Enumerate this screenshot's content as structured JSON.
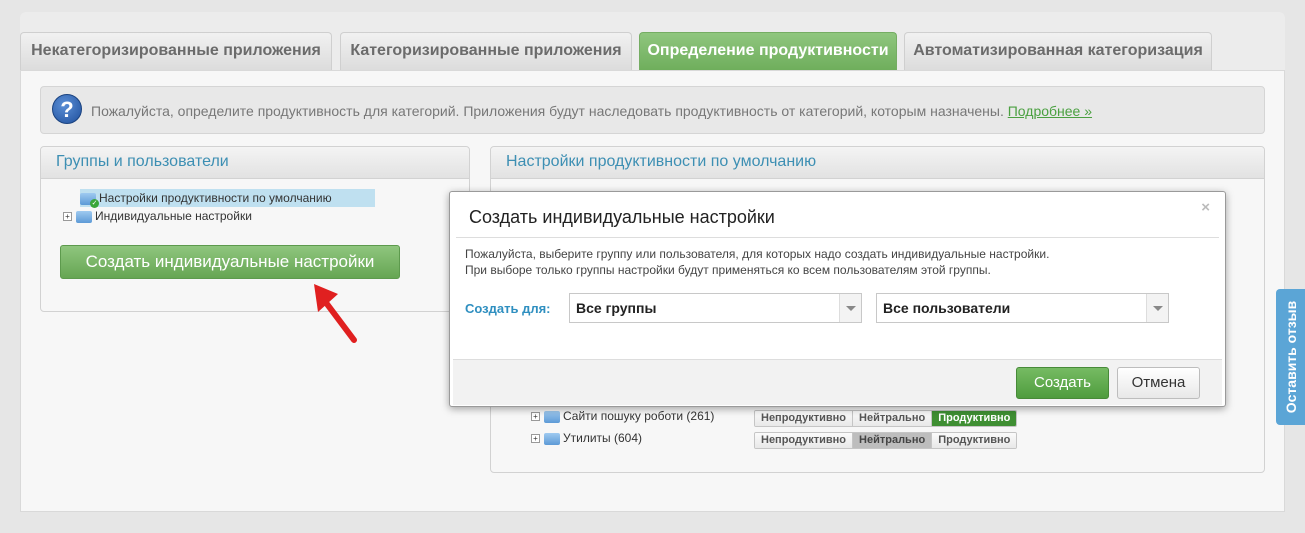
{
  "tabs": [
    {
      "label": "Некатегоризированные приложения",
      "active": false
    },
    {
      "label": "Категоризированные приложения",
      "active": false
    },
    {
      "label": "Определение продуктивности",
      "active": true
    },
    {
      "label": "Автоматизированная категоризация",
      "active": false
    }
  ],
  "info": {
    "icon": "question-icon",
    "text": "Пожалуйста, определите продуктивность для категорий. Приложения будут наследовать продуктивность от категорий, которым назначены.",
    "link": "Подробнее »"
  },
  "groups_panel": {
    "title": "Группы и пользователи",
    "tree": [
      {
        "label": "Настройки продуктивности по умолчанию",
        "selected": true
      },
      {
        "label": "Индивидуальные настройки",
        "selected": false
      }
    ],
    "create_button": "Создать индивидуальные настройки"
  },
  "settings_panel": {
    "title": "Настройки продуктивности по умолчанию",
    "categories": [
      {
        "name": "Сайти пошуку роботи (261)",
        "value": "Продуктивно"
      },
      {
        "name": "Утилиты (604)",
        "value": "Нейтрально"
      }
    ],
    "options": [
      "Непродуктивно",
      "Нейтрально",
      "Продуктивно"
    ]
  },
  "feedback": {
    "label": "Оставить отзыв",
    "color": "#5ba5d6"
  },
  "modal": {
    "title": "Создать индивидуальные настройки",
    "close": "×",
    "desc_line1": "Пожалуйста, выберите группу или пользователя, для которых надо создать индивидуальные настройки.",
    "desc_line2": "При выборе только группы настройки будут применяться ко всем пользователям этой группы.",
    "create_for_label": "Создать для:",
    "group_select": "Все группы",
    "user_select": "Все пользователи",
    "create_button": "Создать",
    "cancel_button": "Отмена"
  },
  "colors": {
    "accent_green": "#6fae5c",
    "title_blue": "#3d8fb3",
    "arrow_red": "#e02020"
  }
}
